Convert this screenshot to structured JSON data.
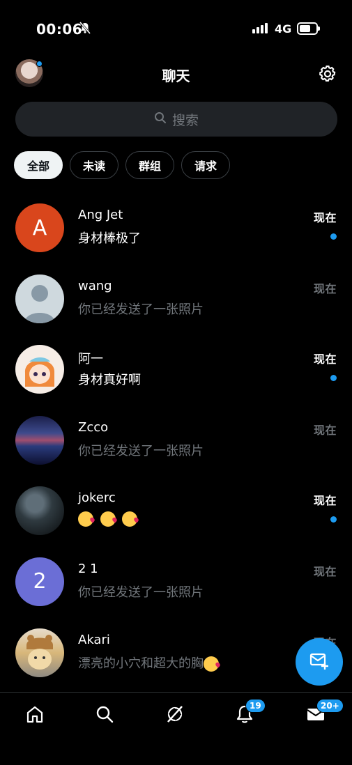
{
  "status_bar": {
    "time": "00:06",
    "network": "4G"
  },
  "header": {
    "title": "聊天"
  },
  "search": {
    "placeholder": "搜索"
  },
  "filters": [
    {
      "label": "全部",
      "active": true
    },
    {
      "label": "未读",
      "active": false
    },
    {
      "label": "群组",
      "active": false
    },
    {
      "label": "请求",
      "active": false
    }
  ],
  "conversations": [
    {
      "name": "Ang Jet",
      "preview": "身材棒极了",
      "time": "现在",
      "unread": true,
      "avatar_letter": "A"
    },
    {
      "name": "wang",
      "preview": "你已经发送了一张照片",
      "time": "现在",
      "unread": false
    },
    {
      "name": "阿一",
      "preview": "身材真好啊",
      "time": "现在",
      "unread": true
    },
    {
      "name": "Zcco",
      "preview": "你已经发送了一张照片",
      "time": "现在",
      "unread": false
    },
    {
      "name": "jokerc",
      "preview": "",
      "time": "现在",
      "unread": true,
      "preview_emojis": [
        "kissing-face-emoji",
        "kissing-face-emoji",
        "kissing-face-emoji"
      ]
    },
    {
      "name": "2 1",
      "preview": "你已经发送了一张照片",
      "time": "现在",
      "unread": false,
      "avatar_letter": "2"
    },
    {
      "name": "Akari",
      "preview": "漂亮的小穴和超大的胸",
      "time": "现在",
      "unread": false,
      "preview_trailing_emoji": "smiling-face-with-hearts-emoji"
    }
  ],
  "bottom_nav": {
    "items": [
      "home-icon",
      "search-icon",
      "grok-icon",
      "notifications-icon",
      "messages-icon"
    ],
    "notifications_badge": "19",
    "messages_badge": "20+"
  },
  "colors": {
    "accent": "#1d9bf0",
    "background": "#000000",
    "muted_text": "#71767b"
  }
}
